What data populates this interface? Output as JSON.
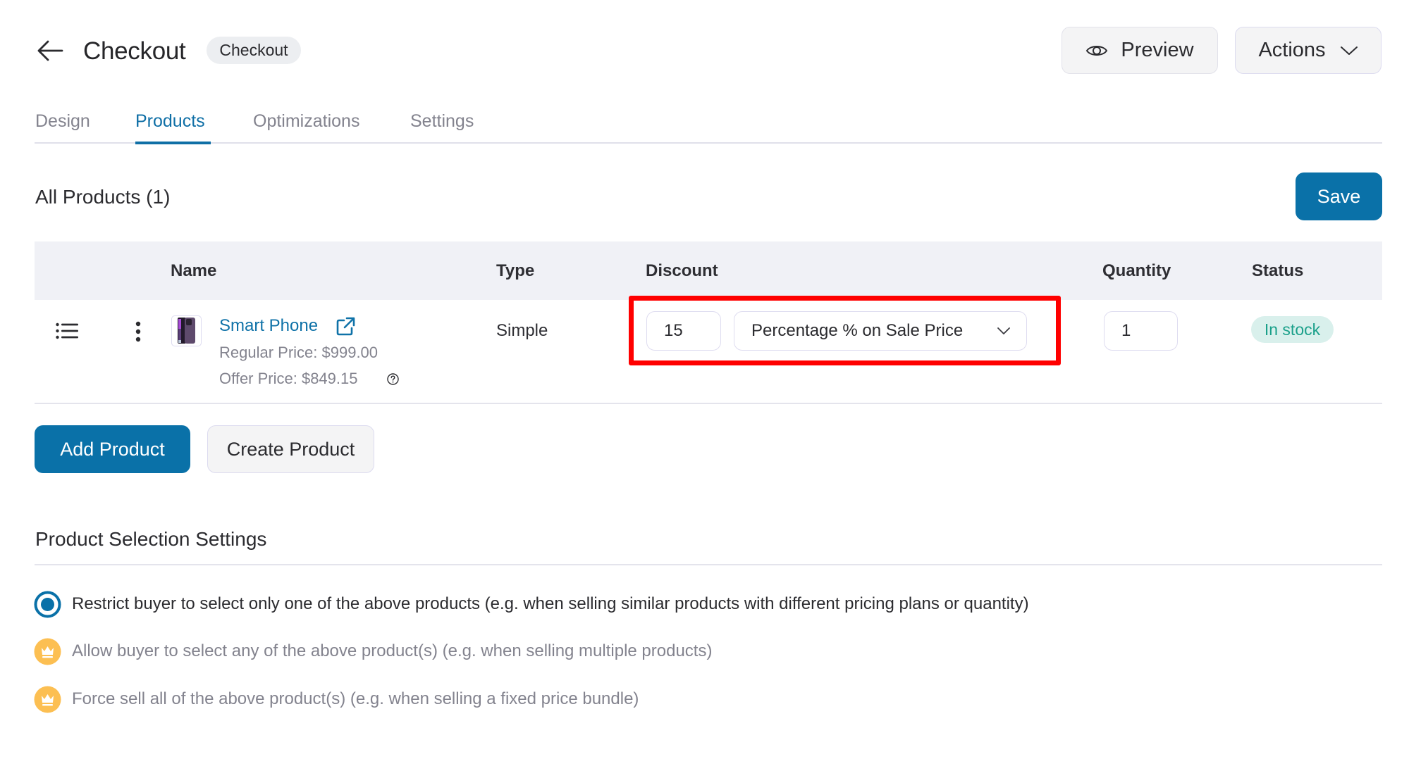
{
  "header": {
    "back_icon": "arrow-left-icon",
    "title": "Checkout",
    "type_badge": "Checkout",
    "preview_label": "Preview",
    "preview_icon": "eye-icon",
    "actions_label": "Actions",
    "actions_icon": "chevron-down-icon"
  },
  "tabs": [
    {
      "label": "Design",
      "active": false
    },
    {
      "label": "Products",
      "active": true
    },
    {
      "label": "Optimizations",
      "active": false
    },
    {
      "label": "Settings",
      "active": false
    }
  ],
  "products_section": {
    "title": "All Products (1)",
    "save_label": "Save"
  },
  "table": {
    "columns": [
      "",
      "",
      "Name",
      "Type",
      "Discount",
      "Quantity",
      "Status"
    ],
    "rows": [
      {
        "name": "Smart Phone",
        "regular_price": "Regular Price: $999.00",
        "offer_price": "Offer Price: $849.15",
        "type": "Simple",
        "discount_value": "15",
        "discount_type": "Percentage % on Sale Price",
        "quantity": "1",
        "status": "In stock"
      }
    ]
  },
  "buttons": {
    "add_product": "Add Product",
    "create_product": "Create Product"
  },
  "selection_settings": {
    "title": "Product Selection Settings",
    "options": [
      {
        "label": "Restrict buyer to select only one of the above products (e.g. when selling similar products with different pricing plans or quantity)",
        "selected": true,
        "locked": false
      },
      {
        "label": "Allow buyer to select any of the above product(s) (e.g. when selling multiple products)",
        "selected": false,
        "locked": true
      },
      {
        "label": "Force sell all of the above product(s) (e.g. when selling a fixed price bundle)",
        "selected": false,
        "locked": true
      }
    ]
  },
  "colors": {
    "accent": "#0a71a8",
    "highlight": "#ff0000",
    "status_bg": "#d9f0ec",
    "status_text": "#1aa08a",
    "pro_badge": "#fcbf52"
  }
}
